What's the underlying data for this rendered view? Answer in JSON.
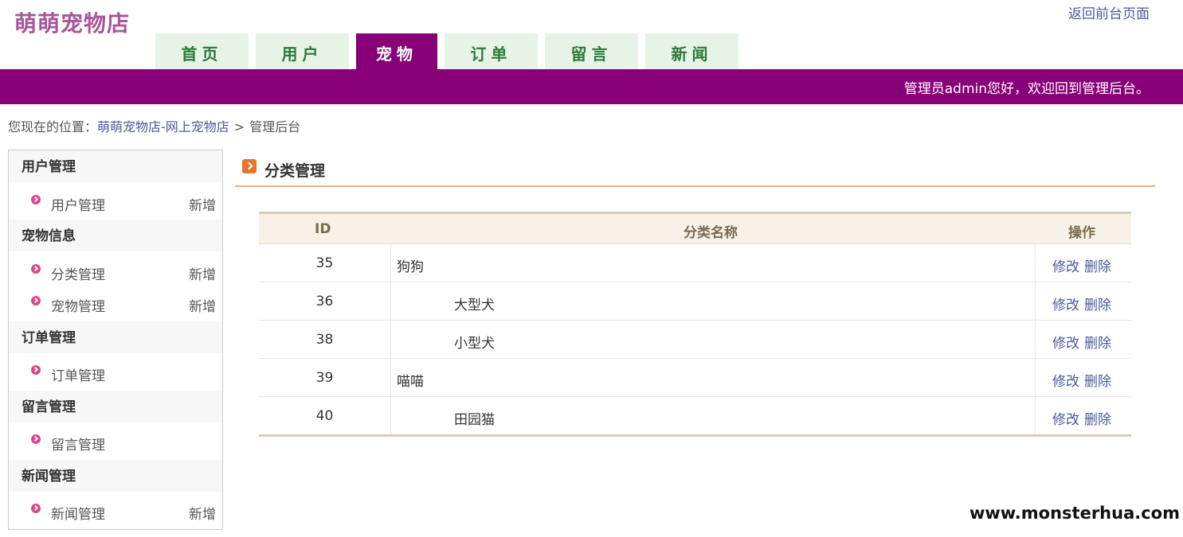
{
  "header": {
    "logo": "萌萌宠物店",
    "front_link": "返回前台页面",
    "welcome": "管理员admin您好，欢迎回到管理后台。"
  },
  "nav": {
    "tabs": [
      {
        "label": "首页",
        "active": false
      },
      {
        "label": "用户",
        "active": false
      },
      {
        "label": "宠物",
        "active": true
      },
      {
        "label": "订单",
        "active": false
      },
      {
        "label": "留言",
        "active": false
      },
      {
        "label": "新闻",
        "active": false
      }
    ]
  },
  "breadcrumb": {
    "prefix": "您现在的位置：",
    "link": "萌萌宠物店-网上宠物店",
    "separator": ">",
    "current": "管理后台"
  },
  "sidebar": {
    "groups": [
      {
        "title": "用户管理",
        "items": [
          {
            "label": "用户管理",
            "add": "新增"
          }
        ]
      },
      {
        "title": "宠物信息",
        "items": [
          {
            "label": "分类管理",
            "add": "新增"
          },
          {
            "label": "宠物管理",
            "add": "新增"
          }
        ]
      },
      {
        "title": "订单管理",
        "items": [
          {
            "label": "订单管理"
          }
        ]
      },
      {
        "title": "留言管理",
        "items": [
          {
            "label": "留言管理"
          }
        ]
      },
      {
        "title": "新闻管理",
        "items": [
          {
            "label": "新闻管理",
            "add": "新增"
          }
        ]
      }
    ]
  },
  "main": {
    "section_title": "分类管理",
    "table": {
      "headers": {
        "id": "ID",
        "name": "分类名称",
        "ops": "操作"
      },
      "rows": [
        {
          "id": "35",
          "name": "狗狗",
          "level": 0
        },
        {
          "id": "36",
          "name": "大型犬",
          "level": 1
        },
        {
          "id": "38",
          "name": "小型犬",
          "level": 1
        },
        {
          "id": "39",
          "name": "喵喵",
          "level": 0
        },
        {
          "id": "40",
          "name": "田园猫",
          "level": 1
        }
      ],
      "op_edit": "修改",
      "op_delete": "删除"
    }
  },
  "watermark": "www.monsterhua.com",
  "colors": {
    "brand_purple": "#880077",
    "tab_green_bg": "#e6f3e6",
    "tab_green_text": "#2c7a3a",
    "logo_pink": "#a8579a",
    "link_blue": "#4a5a9a",
    "accent_orange": "#e8732a"
  }
}
